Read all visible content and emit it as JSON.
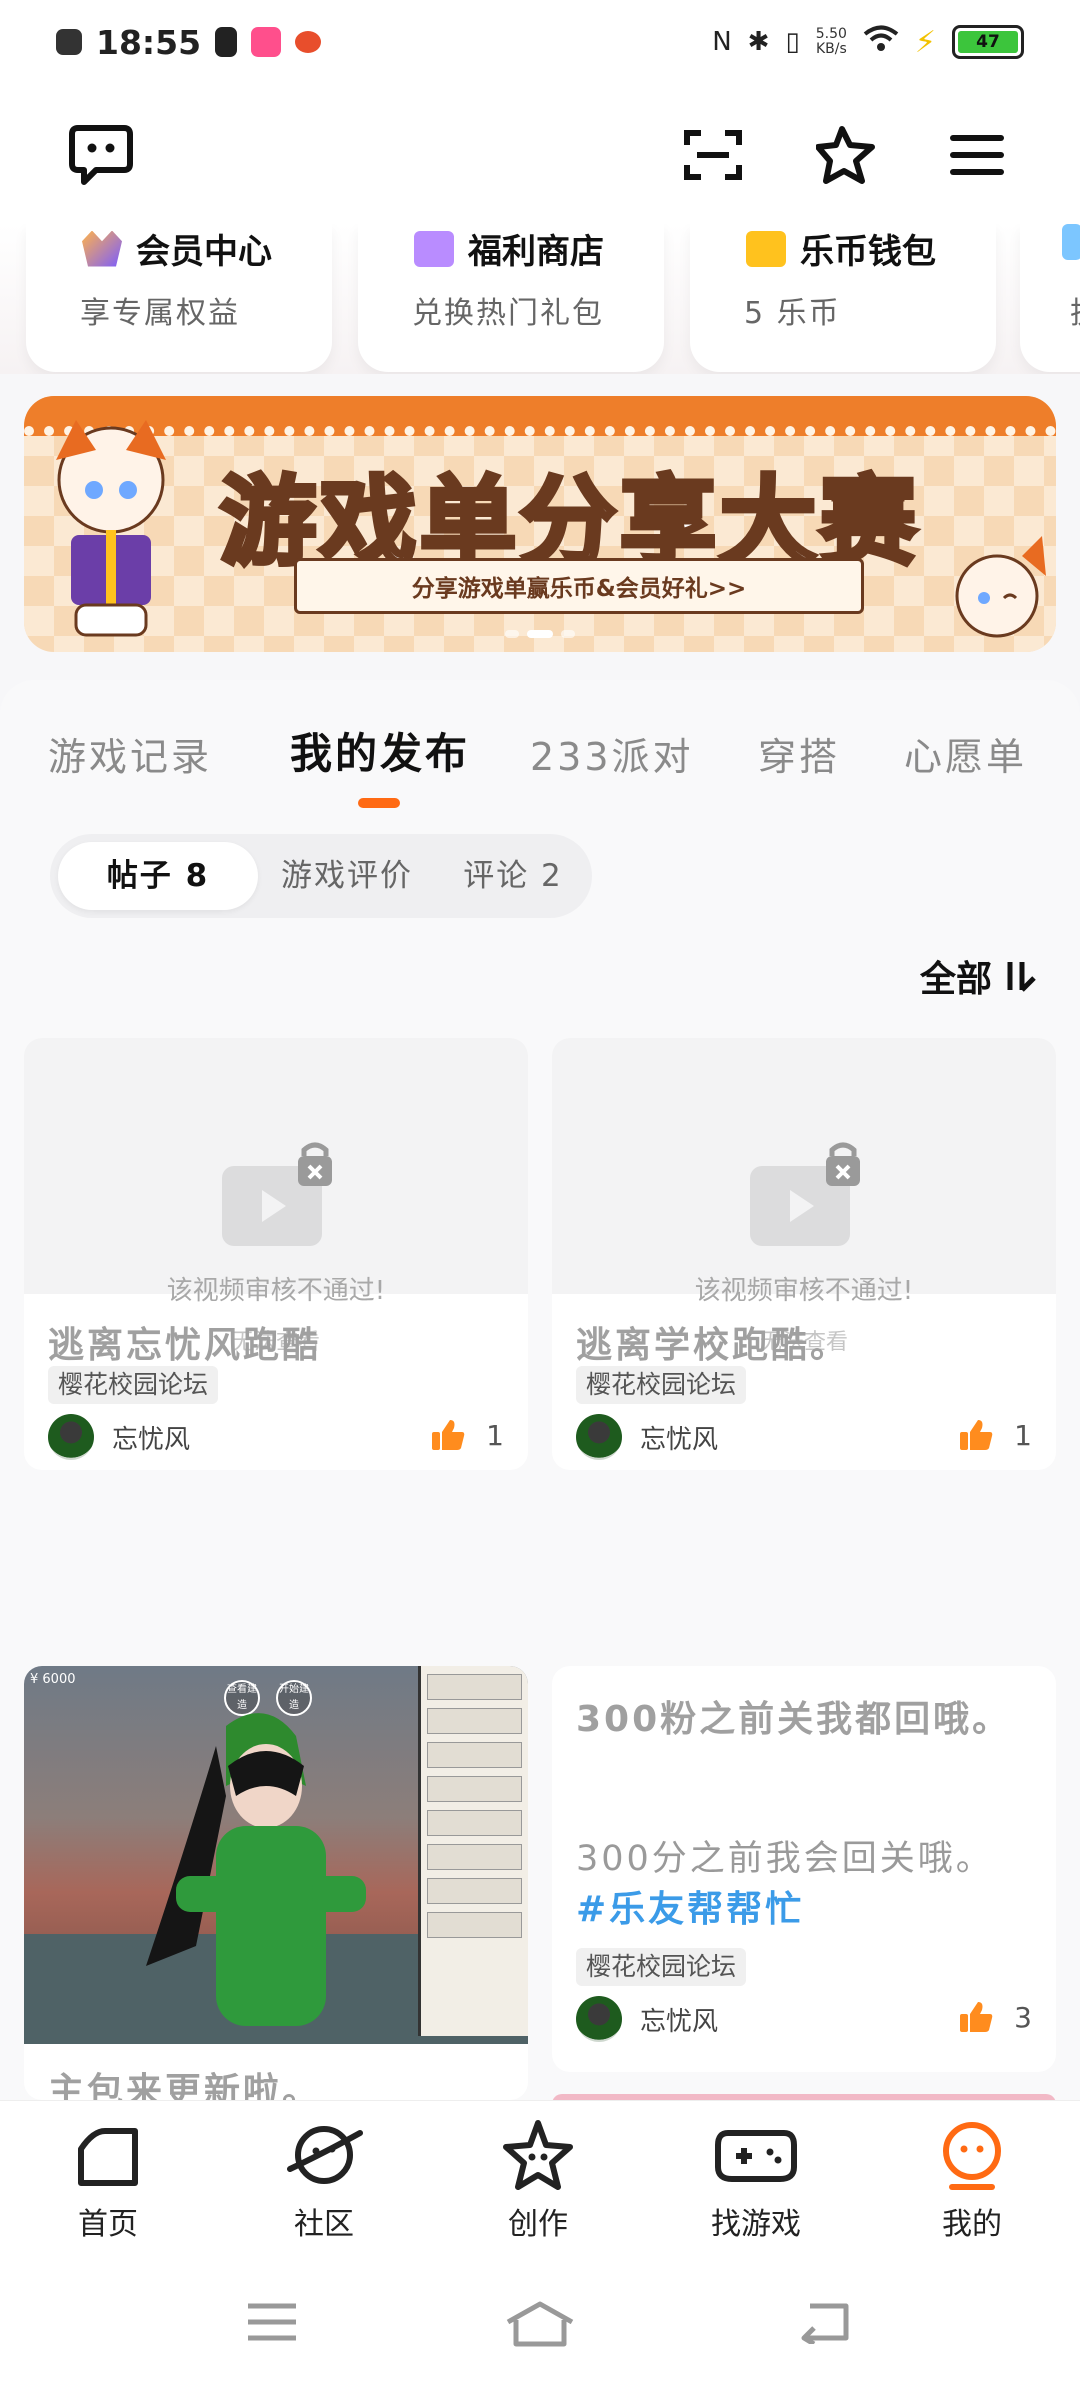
{
  "status_bar": {
    "time": "18:55",
    "net_speed_value": "5.50",
    "net_speed_unit": "KB/s",
    "battery": "47"
  },
  "top_nav": {
    "icons": [
      "chat-icon",
      "scan-icon",
      "star-icon",
      "menu-icon"
    ]
  },
  "shortcuts": [
    {
      "title": "会员中心",
      "subtitle": "享专属权益",
      "color": "#7a5cff"
    },
    {
      "title": "福利商店",
      "subtitle": "兑换热门礼包",
      "color": "#b98cff"
    },
    {
      "title": "乐币钱包",
      "subtitle": "5 乐币",
      "color": "#ffc21e"
    },
    {
      "title": "",
      "subtitle": "执",
      "color": "#7cc6ff"
    }
  ],
  "banner": {
    "title": "游戏单分享大赛",
    "subtitle": "分享游戏单赢乐币&会员好礼>>",
    "dots": 3,
    "active_dot": 1
  },
  "tabs": [
    {
      "label": "游戏记录",
      "active": false
    },
    {
      "label": "我的发布",
      "active": true
    },
    {
      "label": "233派对",
      "active": false
    },
    {
      "label": "穿搭",
      "active": false
    },
    {
      "label": "心愿单",
      "active": false
    }
  ],
  "segments": [
    {
      "label": "帖子 8",
      "active": true
    },
    {
      "label": "游戏评价",
      "active": false
    },
    {
      "label": "评论 2",
      "active": false
    }
  ],
  "filter": {
    "label": "全部"
  },
  "posts": [
    {
      "media_line1": "该视频审核不通过!",
      "media_line2": "无法查看",
      "title": "逃离忘忧风跑酷",
      "tag": "樱花校园论坛",
      "author": "忘忧风",
      "likes": "1"
    },
    {
      "media_line1": "该视频审核不通过!",
      "media_line2": "无法查看",
      "title": "逃离学校跑酷。",
      "tag": "樱花校园论坛",
      "author": "忘忧风",
      "likes": "1"
    },
    {
      "title": "主包来更新啦。",
      "shot_price": "¥ 6000",
      "shot_btn1": "查看建造",
      "shot_btn2": "开始建造"
    },
    {
      "title": "300粉之前关我都回哦。",
      "body": "300分之前我会回关哦。",
      "hashtag": "#乐友帮帮忙",
      "tag": "樱花校园论坛",
      "author": "忘忧风",
      "likes": "3"
    }
  ],
  "bottom_nav": [
    {
      "label": "首页",
      "icon": "home-icon"
    },
    {
      "label": "社区",
      "icon": "planet-icon"
    },
    {
      "label": "创作",
      "icon": "create-star-icon"
    },
    {
      "label": "找游戏",
      "icon": "gamepad-icon"
    },
    {
      "label": "我的",
      "icon": "profile-icon",
      "active": true
    }
  ],
  "accent_color": "#ff6a13"
}
